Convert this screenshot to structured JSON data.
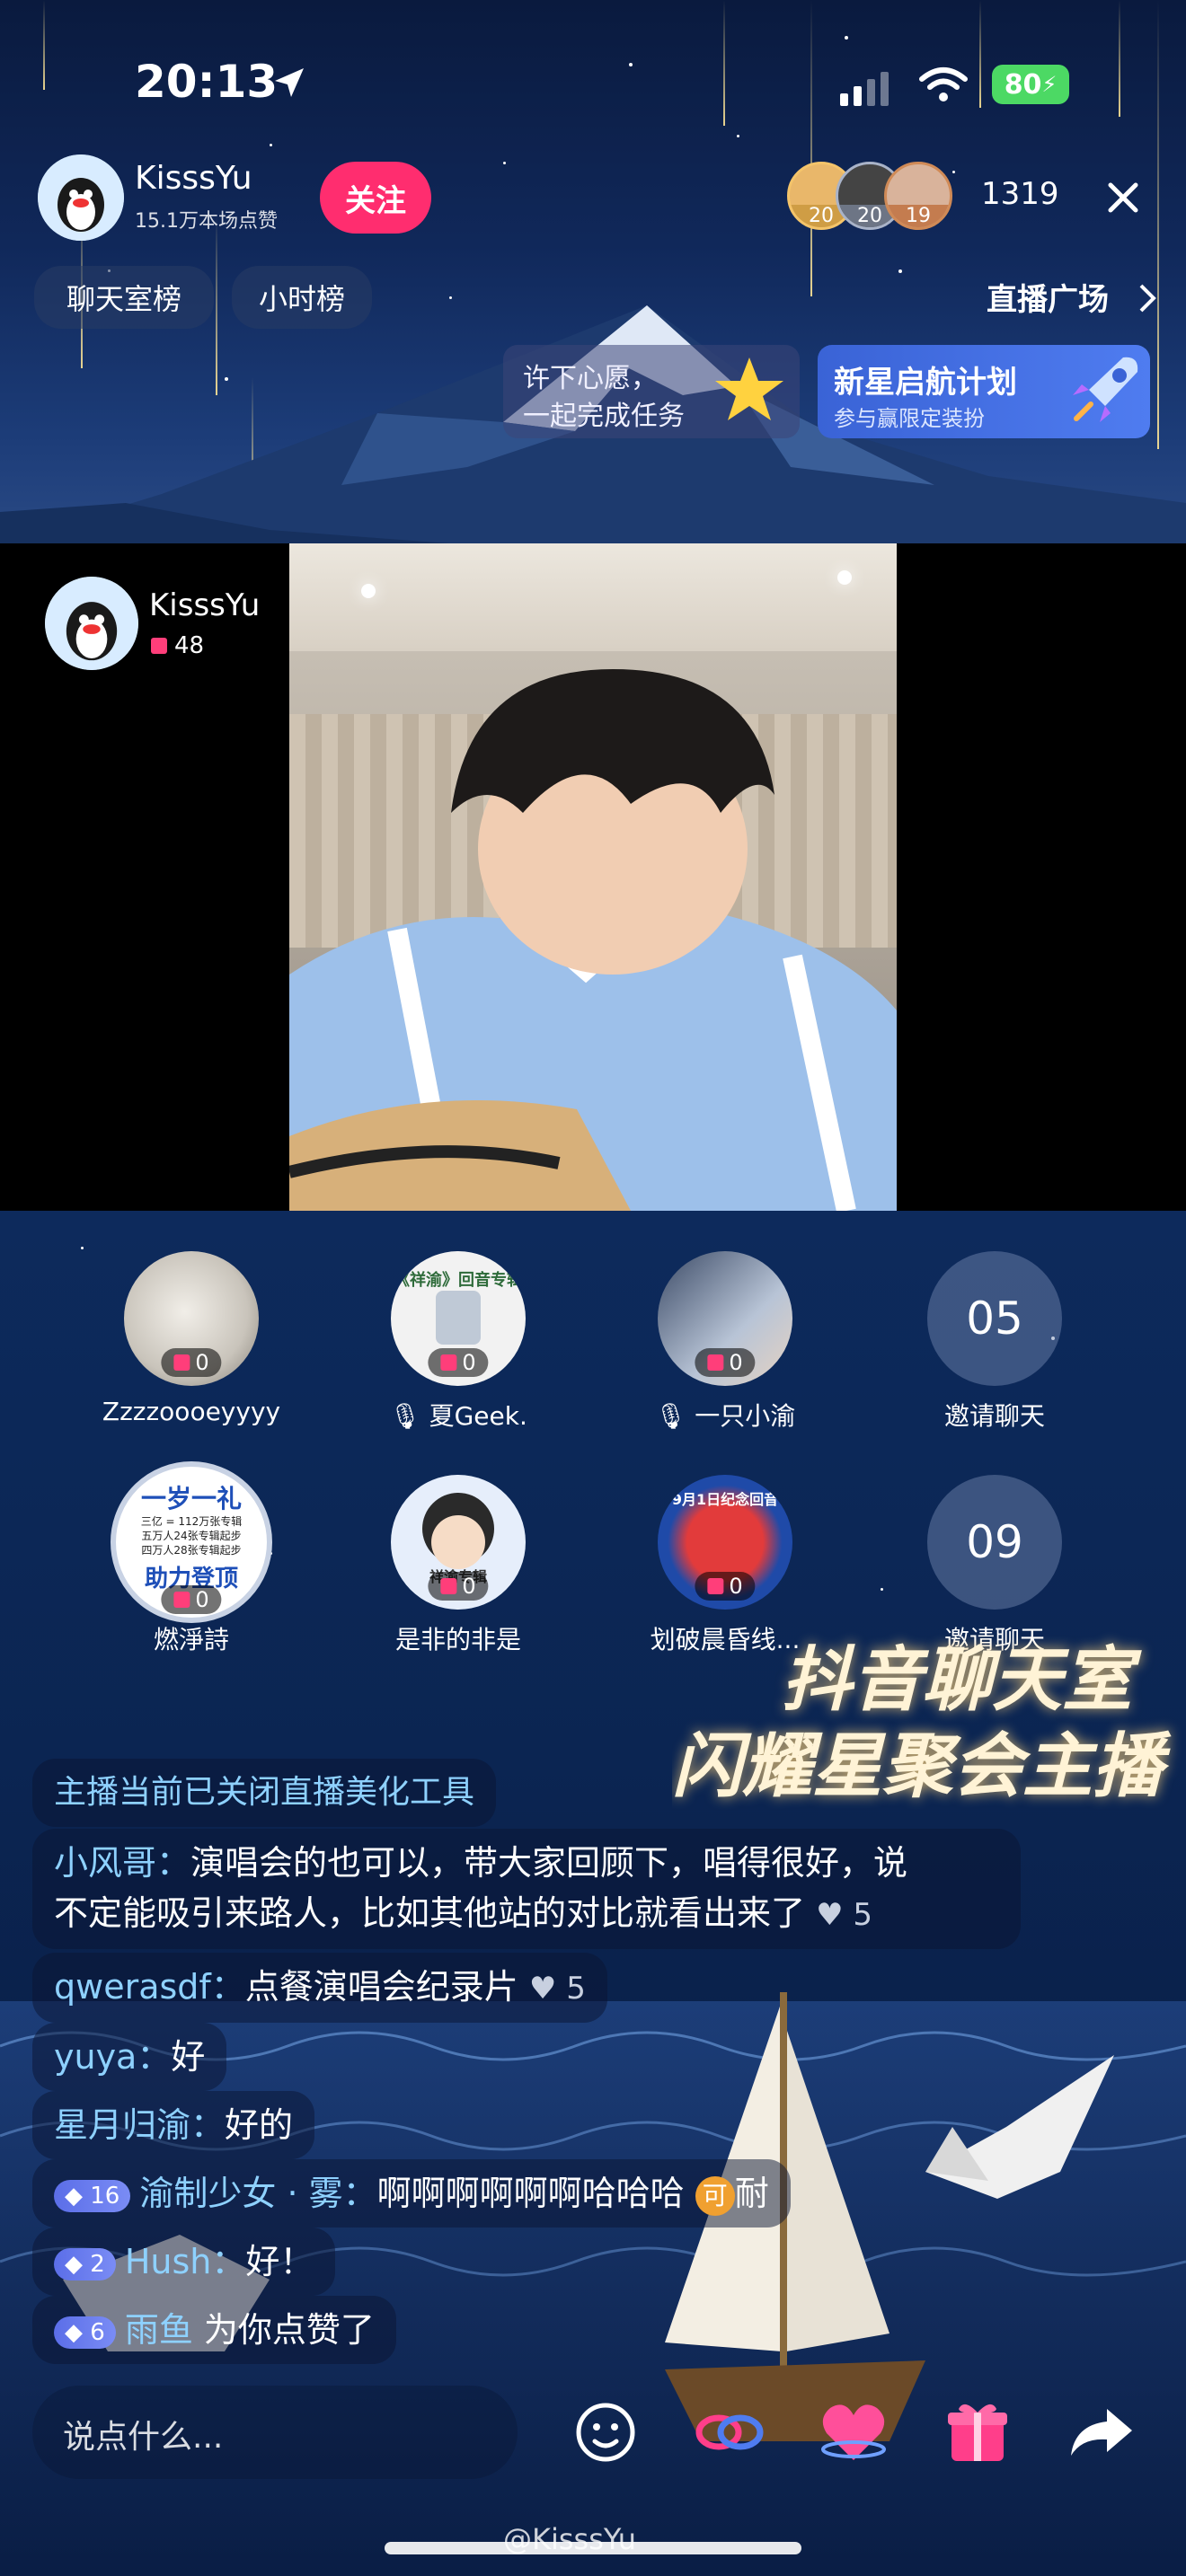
{
  "status_bar": {
    "time": "20:13",
    "battery": "80"
  },
  "host": {
    "name": "KisssYu",
    "likes": "15.1万本场点赞",
    "follow_label": "关注"
  },
  "viewers": {
    "badges": [
      "20",
      "20",
      "19"
    ],
    "count": "1319"
  },
  "tabs": {
    "chat_rank": "聊天室榜",
    "hour_rank": "小时榜",
    "plaza": "直播广场"
  },
  "banners": {
    "wish_line1": "许下心愿，",
    "wish_line2": "一起完成任务",
    "plan_title": "新星启航计划",
    "plan_sub": "参与赢限定装扮"
  },
  "stage": {
    "host_name": "KisssYu",
    "host_gifts": "48"
  },
  "seats": [
    {
      "name": "Zzzzoooeyyyy",
      "count": "0",
      "muted": false
    },
    {
      "name": "夏Geek.",
      "count": "0",
      "muted": true
    },
    {
      "name": "一只小渝",
      "count": "0",
      "muted": true
    },
    {
      "name": "邀请聊天",
      "number": "05"
    },
    {
      "name": "燃淨詩",
      "count": "0",
      "muted": false
    },
    {
      "name": "是非的非是",
      "count": "0",
      "muted": false
    },
    {
      "name": "划破晨昏线...",
      "count": "0",
      "muted": false
    },
    {
      "name": "邀请聊天",
      "number": "09"
    }
  ],
  "seat_images": {
    "seat2_text": "《祥渝》回音专辑",
    "seat5_line1": "一岁一礼",
    "seat5_line2": "三亿 = 112万张专辑",
    "seat5_line3": "五万人24张专辑起步",
    "seat5_line4": "四万人28张专辑起步",
    "seat5_line5": "助力登顶",
    "seat6_text": "祥渝专辑",
    "seat7_text": "9月1日纪念回音"
  },
  "promo": {
    "line1": "抖音聊天室",
    "line2": "闪耀星聚会主播"
  },
  "chat": {
    "system": "主播当前已关闭直播美化工具",
    "messages": [
      {
        "user": "小风哥：",
        "text": "演唱会的也可以，带大家回顾下，唱得很好，说",
        "text2": "不定能吸引来路人，比如其他站的对比就看出来了",
        "likes": "5"
      },
      {
        "user": "qwerasdf：",
        "text": "点餐演唱会纪录片",
        "likes": "5"
      },
      {
        "user": "yuya：",
        "text": "好"
      },
      {
        "user": "星月归渝：",
        "text": "好的"
      },
      {
        "level": "16",
        "user": "渝制少女 · 雾：",
        "text": "啊啊啊啊啊啊哈哈哈",
        "extra_badge": "可",
        "extra": "耐"
      },
      {
        "level": "2",
        "user": "Hush：",
        "text": "好！"
      },
      {
        "level": "6",
        "user": "雨鱼",
        "text": "为你点赞了"
      }
    ]
  },
  "input": {
    "placeholder": "说点什么..."
  },
  "watermark": "@KisssYu",
  "colors": {
    "follow": "#ff2d6f",
    "accent_blue": "#8ed1ff",
    "battery": "#4cd964"
  }
}
